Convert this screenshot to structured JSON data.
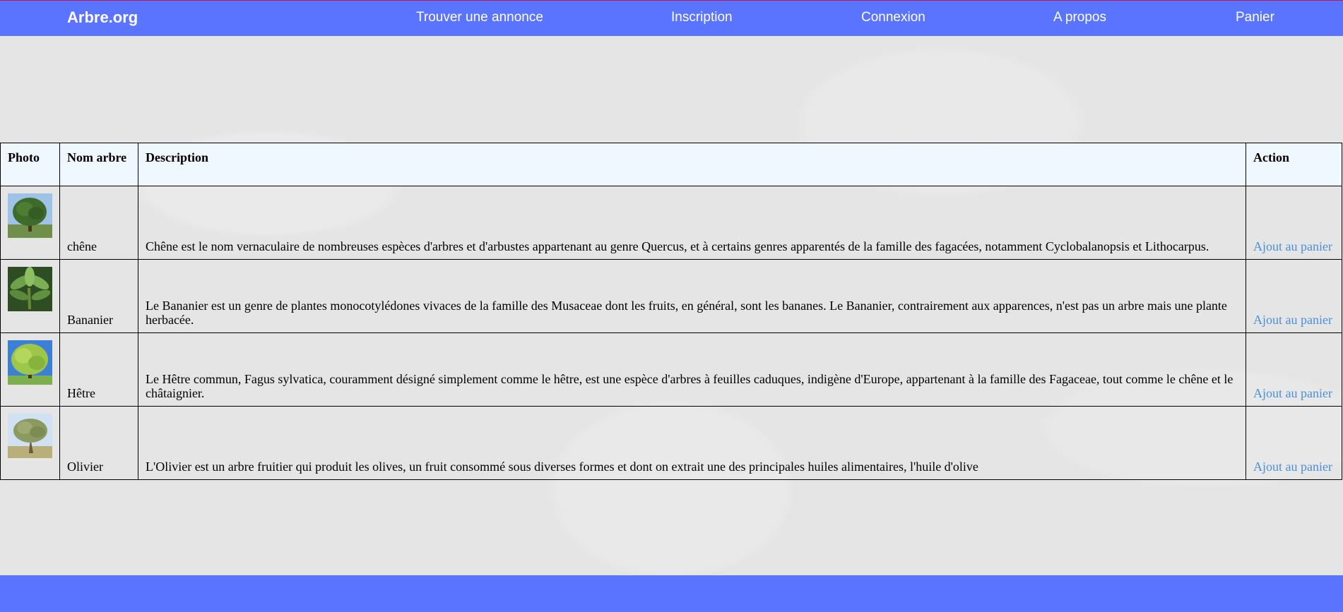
{
  "header": {
    "brand": "Arbre.org",
    "nav": {
      "find_ad": "Trouver une annonce",
      "register": "Inscription",
      "login": "Connexion",
      "about": "A propos",
      "cart": "Panier"
    }
  },
  "colors": {
    "header_bg": "#5b74ff",
    "footer_bg": "#5b74ff",
    "page_bg": "#e5e5e5",
    "table_header_bg": "#f0f8ff",
    "link": "#4a90d9"
  },
  "table": {
    "headers": {
      "photo": "Photo",
      "name": "Nom arbre",
      "description": "Description",
      "action": "Action"
    },
    "rows": [
      {
        "photo_icon": "oak-tree-photo",
        "name": "chêne",
        "description": "Chêne est le nom vernaculaire de nombreuses espèces d'arbres et d'arbustes appartenant au genre Quercus, et à certains genres apparentés de la famille des fagacées, notamment Cyclobalanopsis et Lithocarpus.",
        "action": "Ajout au panier"
      },
      {
        "photo_icon": "banana-plant-photo",
        "name": "Bananier",
        "description": "Le Bananier est un genre de plantes monocotylédones vivaces de la famille des Musaceae dont les fruits, en général, sont les bananes. Le Bananier, contrairement aux apparences, n'est pas un arbre mais une plante herbacée.",
        "action": "Ajout au panier"
      },
      {
        "photo_icon": "beech-tree-photo",
        "name": "Hêtre",
        "description": "Le Hêtre commun, Fagus sylvatica, couramment désigné simplement comme le hêtre, est une espèce d'arbres à feuilles caduques, indigène d'Europe, appartenant à la famille des Fagaceae, tout comme le chêne et le châtaignier.",
        "action": "Ajout au panier"
      },
      {
        "photo_icon": "olive-tree-photo",
        "name": "Olivier",
        "description": "L'Olivier est un arbre fruitier qui produit les olives, un fruit consommé sous diverses formes et dont on extrait une des principales huiles alimentaires, l'huile d'olive",
        "action": "Ajout au panier"
      }
    ]
  }
}
